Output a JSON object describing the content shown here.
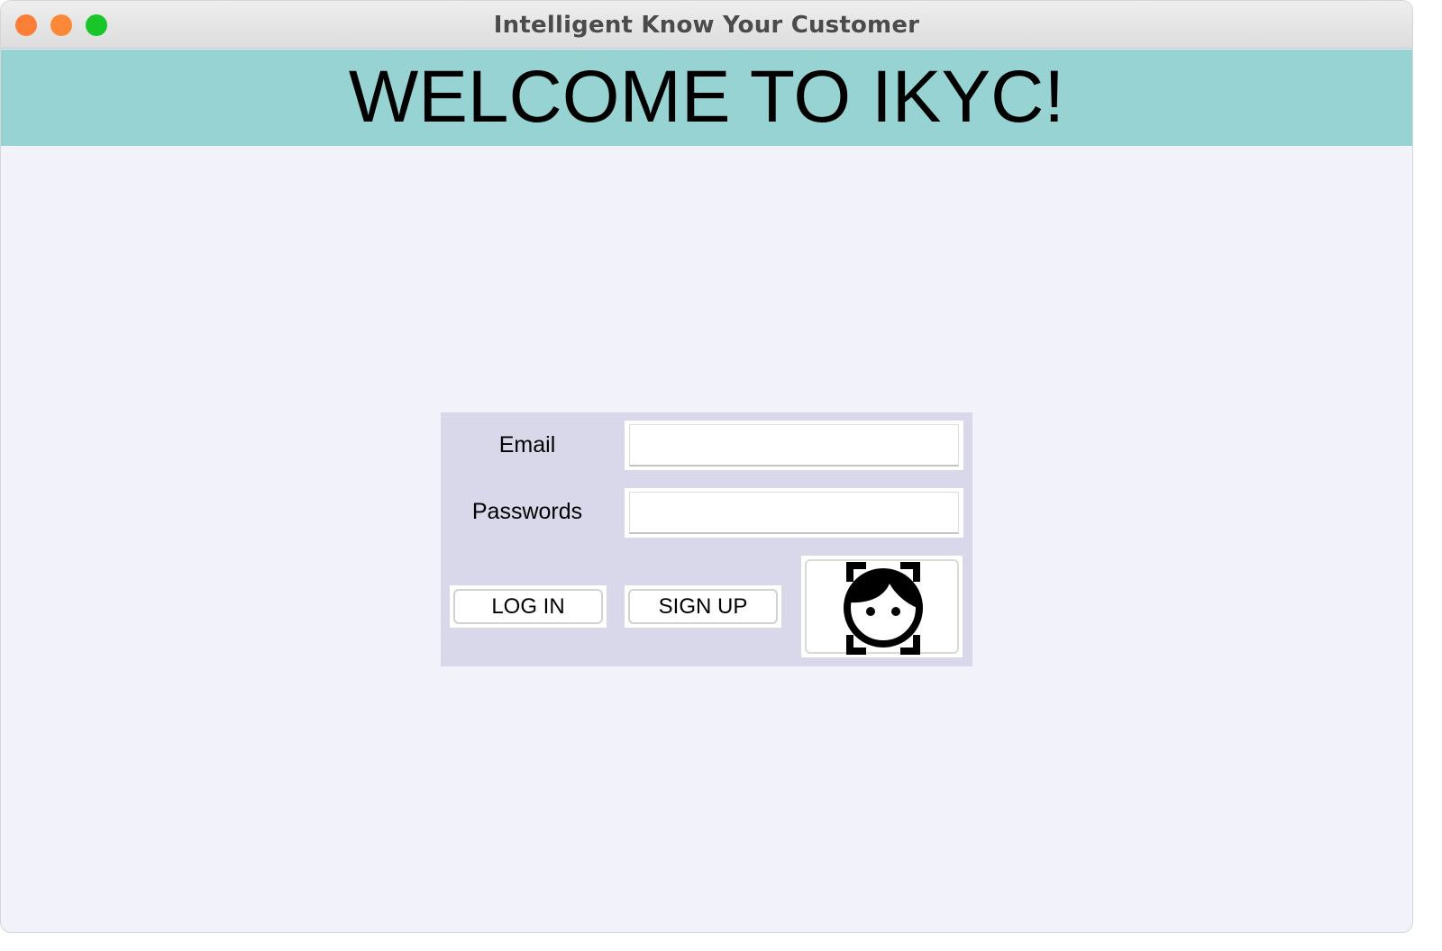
{
  "window": {
    "title": "Intelligent Know Your Customer",
    "controls": [
      "close",
      "minimize",
      "maximize"
    ]
  },
  "header": {
    "welcome_text": "WELCOME TO IKYC!"
  },
  "login": {
    "email_label": "Email",
    "email_value": "",
    "password_label": "Passwords",
    "password_value": "",
    "login_button": "LOG IN",
    "signup_button": "SIGN UP",
    "face_login_icon": "face-recognition-icon"
  },
  "colors": {
    "header_background": "#97d3d3",
    "panel_background": "#d8d8ea",
    "window_background": "#f2f3fa",
    "close_control": "#fb7f37",
    "minimize_control": "#fb8937",
    "maximize_control": "#18c629"
  }
}
